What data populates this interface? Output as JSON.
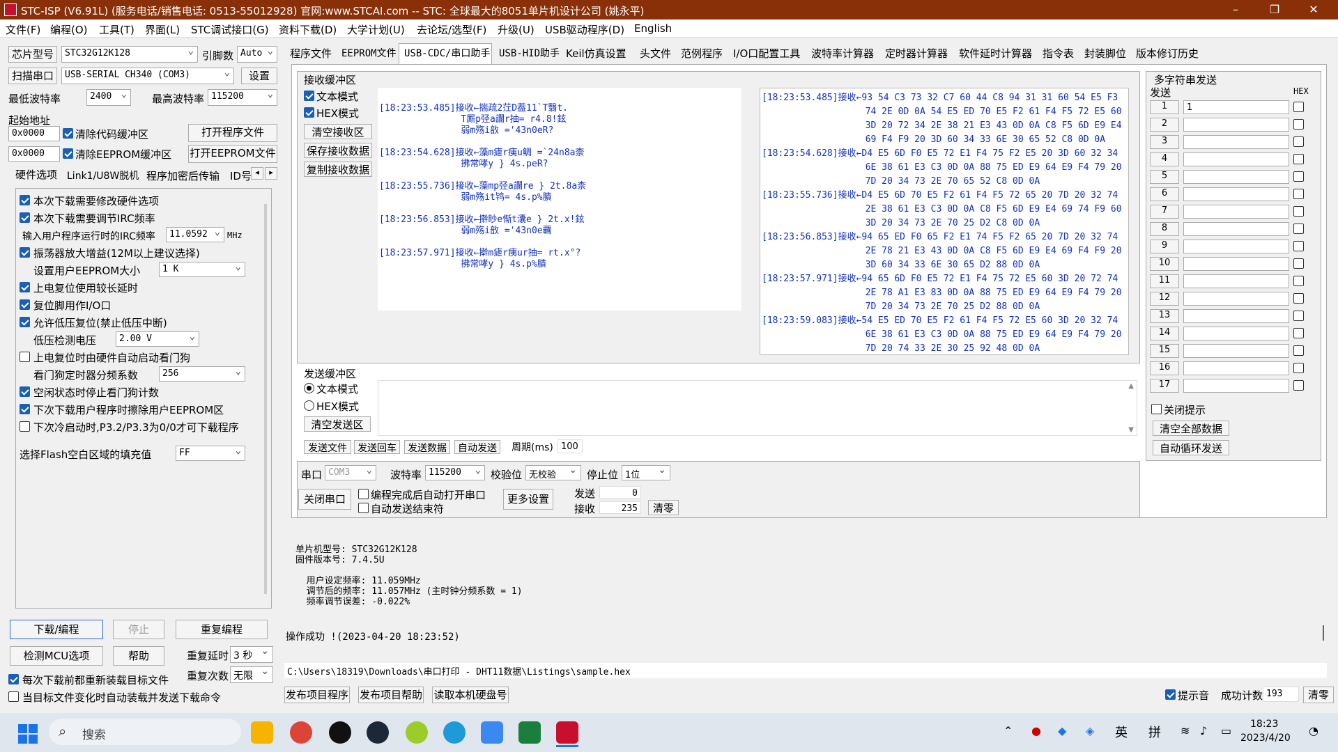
{
  "window": {
    "title": "STC-ISP (V6.91L) (服务电话/销售电话: 0513-55012928) 官网:www.STCAI.com  -- STC: 全球最大的8051单片机设计公司 (姚永平)",
    "minimize": "–",
    "maximize": "❐",
    "close": "✕"
  },
  "menu": [
    "文件(F)",
    "编程(O)",
    "工具(T)",
    "界面(L)",
    "STC调试接口(G)",
    "资料下载(D)",
    "大学计划(U)",
    "去论坛/选型(F)",
    "升级(U)",
    "USB驱动程序(D)",
    "English"
  ],
  "left": {
    "chip_label": "芯片型号",
    "chip_value": "STC32G12K128",
    "pin_label": "引脚数",
    "pin_value": "Auto",
    "scan_label": "扫描串口",
    "port_value": "USB-SERIAL CH340 (COM3)",
    "settings_btn": "设置",
    "min_baud_label": "最低波特率",
    "min_baud": "2400",
    "max_baud_label": "最高波特率",
    "max_baud": "115200",
    "start_addr_label": "起始地址",
    "addr1": "0x0000",
    "clear_code": "清除代码缓冲区",
    "open_prog": "打开程序文件",
    "addr2": "0x0000",
    "clear_eeprom": "清除EEPROM缓冲区",
    "open_eeprom": "打开EEPROM文件",
    "tabs": [
      "硬件选项",
      "Link1/U8W脱机",
      "程序加密后传输",
      "ID号"
    ],
    "options": [
      {
        "text": "本次下载需要修改硬件选项",
        "checked": true
      },
      {
        "text": "本次下载需要调节IRC频率",
        "checked": true
      }
    ],
    "irc_label": "输入用户程序运行时的IRC频率",
    "irc_value": "11.0592",
    "irc_unit": "MHz",
    "osc": "振荡器放大增益(12M以上建议选择)",
    "eeprom_label": "设置用户EEPROM大小",
    "eeprom_value": "1   K",
    "opt2": [
      {
        "text": "上电复位使用较长延时",
        "checked": true
      },
      {
        "text": "复位脚用作I/O口",
        "checked": true
      },
      {
        "text": "允许低压复位(禁止低压中断)",
        "checked": true
      }
    ],
    "lv_label": "低压检测电压",
    "lv_value": "2.00 V",
    "wdt_auto": "上电复位时由硬件自动启动看门狗",
    "wdt_label": "看门狗定时器分频系数",
    "wdt_value": "256",
    "opt3": [
      {
        "text": "空闲状态时停止看门狗计数",
        "checked": true
      },
      {
        "text": "下次下载用户程序时擦除用户EEPROM区",
        "checked": true
      },
      {
        "text": "下次冷启动时,P3.2/P3.3为0/0才可下载程序",
        "checked": false
      }
    ],
    "flash_label": "选择Flash空白区域的填充值",
    "flash_value": "FF",
    "download_btn": "下载/编程",
    "stop_btn": "停止",
    "reprog_btn": "重复编程",
    "detect_btn": "检测MCU选项",
    "help_btn": "帮助",
    "delay_label": "重复延时",
    "delay_value": "3 秒",
    "count_label": "重复次数",
    "count_value": "无限",
    "reload": "每次下载前都重新装载目标文件",
    "auto_send": "当目标文件变化时自动装载并发送下载命令"
  },
  "tabs": [
    "程序文件",
    "EEPROM文件",
    "USB-CDC/串口助手",
    "USB-HID助手",
    "Keil仿真设置",
    "头文件",
    "范例程序",
    "I/O口配置工具",
    "波特率计算器",
    "定时器计算器",
    "软件延时计算器",
    "指令表",
    "封装脚位",
    "版本修订历史"
  ],
  "rx": {
    "title": "接收缓冲区",
    "text_mode": "文本模式",
    "hex_mode": "HEX模式",
    "clear": "清空接收区",
    "save": "保存接收数据",
    "copy": "复制接收数据",
    "text_lines": [
      "[18:23:53.485]接收←揣疏2茳D葢11`T翳t.",
      "               T厮p弪a讕r抽= r4.8!鉉",
      "               弱m殇i敨 ='43n0eR?",
      "",
      "[18:23:54.628]接收←藻m瘧r痍u鲷 =`24n8a柰",
      "               拂常哮y } 4s.peR?",
      "",
      "[18:23:55.736]接收←藻mp弪a讕re } 2t.8a柰",
      "               弱m殇it鸨= 4s.p%膭",
      "",
      "[18:23:56.853]接收←擀眇e惭t灢e } 2t.x!鉉",
      "               弱m殇i敨 ='43n0e覊",
      "",
      "[18:23:57.971]接收←擀m瘧r痍ur抽= rt.x°?",
      "               拂常哮y } 4s.p%膭"
    ],
    "hex_lines": [
      "[18:23:53.485]接收←93 54 C3 73 32 C7 60 44 C8 94 31 31 60 54 E5 F3",
      "                   74 2E 0D 0A 54 E5 ED 70 E5 F2 61 F4 F5 72 E5 60",
      "                   3D 20 72 34 2E 38 21 E3 43 0D 0A C8 F5 6D E9 E4",
      "                   69 F4 F9 20 3D 60 34 33 6E 30 65 52 C8 0D 0A",
      "[18:23:54.628]接收←D4 E5 6D F0 E5 72 E1 F4 75 F2 E5 20 3D 60 32 34",
      "                   6E 38 61 E3 C3 0D 0A 88 75 ED E9 64 E9 F4 79 20",
      "                   7D 20 34 73 2E 70 65 52 C8 0D 0A",
      "[18:23:55.736]接收←D4 E5 6D 70 E5 F2 61 F4 F5 72 65 20 7D 20 32 74",
      "                   2E 38 61 E3 C3 0D 0A C8 F5 6D E9 E4 69 74 F9 60",
      "                   3D 20 34 73 2E 70 25 D2 C8 0D 0A",
      "[18:23:56.853]接收←94 65 ED F0 65 F2 E1 74 F5 F2 65 20 7D 20 32 74",
      "                   2E 78 21 E3 43 0D 0A C8 F5 6D E9 E4 69 F4 F9 20",
      "                   3D 60 34 33 6E 30 65 D2 88 0D 0A",
      "[18:23:57.971]接收←94 65 6D F0 E5 72 E1 F4 75 72 E5 60 3D 20 72 74",
      "                   2E 78 A1 E3 83 0D 0A 88 75 ED E9 64 E9 F4 79 20",
      "                   7D 20 34 73 2E 70 25 D2 88 0D 0A",
      "[18:23:59.083]接收←54 E5 ED 70 E5 F2 61 F4 F5 72 E5 60 3D 20 32 74",
      "                   6E 38 61 E3 C3 0D 0A 88 75 ED E9 64 E9 F4 79 20",
      "                   7D 20 74 33 2E 30 25 92 48 0D 0A"
    ]
  },
  "tx": {
    "title": "发送缓冲区",
    "text_mode": "文本模式",
    "hex_mode": "HEX模式",
    "clear": "清空发送区",
    "send_file": "发送文件",
    "send_enter": "发送回车",
    "send_data": "发送数据",
    "auto_send": "自动发送",
    "period_label": "周期(ms)",
    "period_value": "100"
  },
  "serial": {
    "port_label": "串口",
    "port_value": "COM3",
    "baud_label": "波特率",
    "baud_value": "115200",
    "parity_label": "校验位",
    "parity_value": "无校验",
    "stop_label": "停止位",
    "stop_value": "1位",
    "close_btn": "关闭串口",
    "auto_open": "编程完成后自动打开串口",
    "auto_end": "自动发送结束符",
    "more_btn": "更多设置",
    "sent_label": "发送",
    "sent_value": "0",
    "recv_label": "接收",
    "recv_value": "235",
    "clear_btn": "清零"
  },
  "multi": {
    "title": "多字符串发送",
    "send_label": "发送",
    "hex_label": "HEX",
    "rows": [
      "1",
      "2",
      "3",
      "4",
      "5",
      "6",
      "7",
      "8",
      "9",
      "10",
      "11",
      "12",
      "13",
      "14",
      "15",
      "16",
      "17"
    ],
    "first_value": "1",
    "close_tip": "关闭提示",
    "clear_all": "清空全部数据",
    "auto_loop": "自动循环发送"
  },
  "log": {
    "lines": [
      "单片机型号: STC32G12K128",
      "固件版本号: 7.4.5U",
      "",
      "  用户设定频率: 11.059MHz",
      "  调节后的频率: 11.057MHz (主时钟分频系数 = 1)",
      "  频率调节误差: -0.022%"
    ],
    "success": "操作成功 !(2023-04-20 18:23:52)"
  },
  "path": "C:\\Users\\18319\\Downloads\\串口打印 - DHT11数据\\Listings\\sample.hex",
  "bottom": {
    "publish_prog": "发布项目程序",
    "publish_help": "发布项目帮助",
    "read_disk": "读取本机硬盘号",
    "beep": "提示音",
    "success_label": "成功计数",
    "success_value": "193",
    "clear": "清零"
  },
  "taskbar": {
    "search": "搜索",
    "time": "18:23",
    "date": "2023/4/20",
    "lang": "英",
    "ime": "拼"
  }
}
